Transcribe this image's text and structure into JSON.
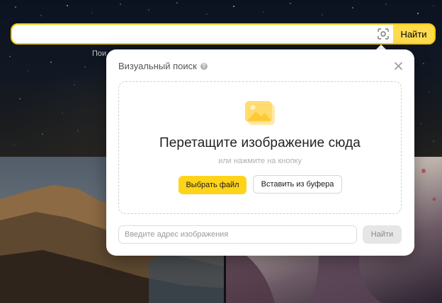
{
  "search": {
    "value": "",
    "submit_label": "Найти",
    "hint_fragment": "Пои"
  },
  "popup": {
    "title": "Визуальный поиск",
    "drop_heading": "Перетащите изображение сюда",
    "drop_subtext": "или нажмите на кнопку",
    "choose_file_label": "Выбрать файл",
    "paste_label": "Вставить из буфера",
    "url_placeholder": "Введите адрес изображения",
    "url_submit_label": "Найти"
  },
  "colors": {
    "accent": "#ffcc00",
    "button_yellow": "#ffd31a",
    "popup_bg": "#ffffff"
  },
  "icons": [
    "camera-lens-icon",
    "help-icon",
    "close-icon",
    "image-placeholder-icon"
  ]
}
